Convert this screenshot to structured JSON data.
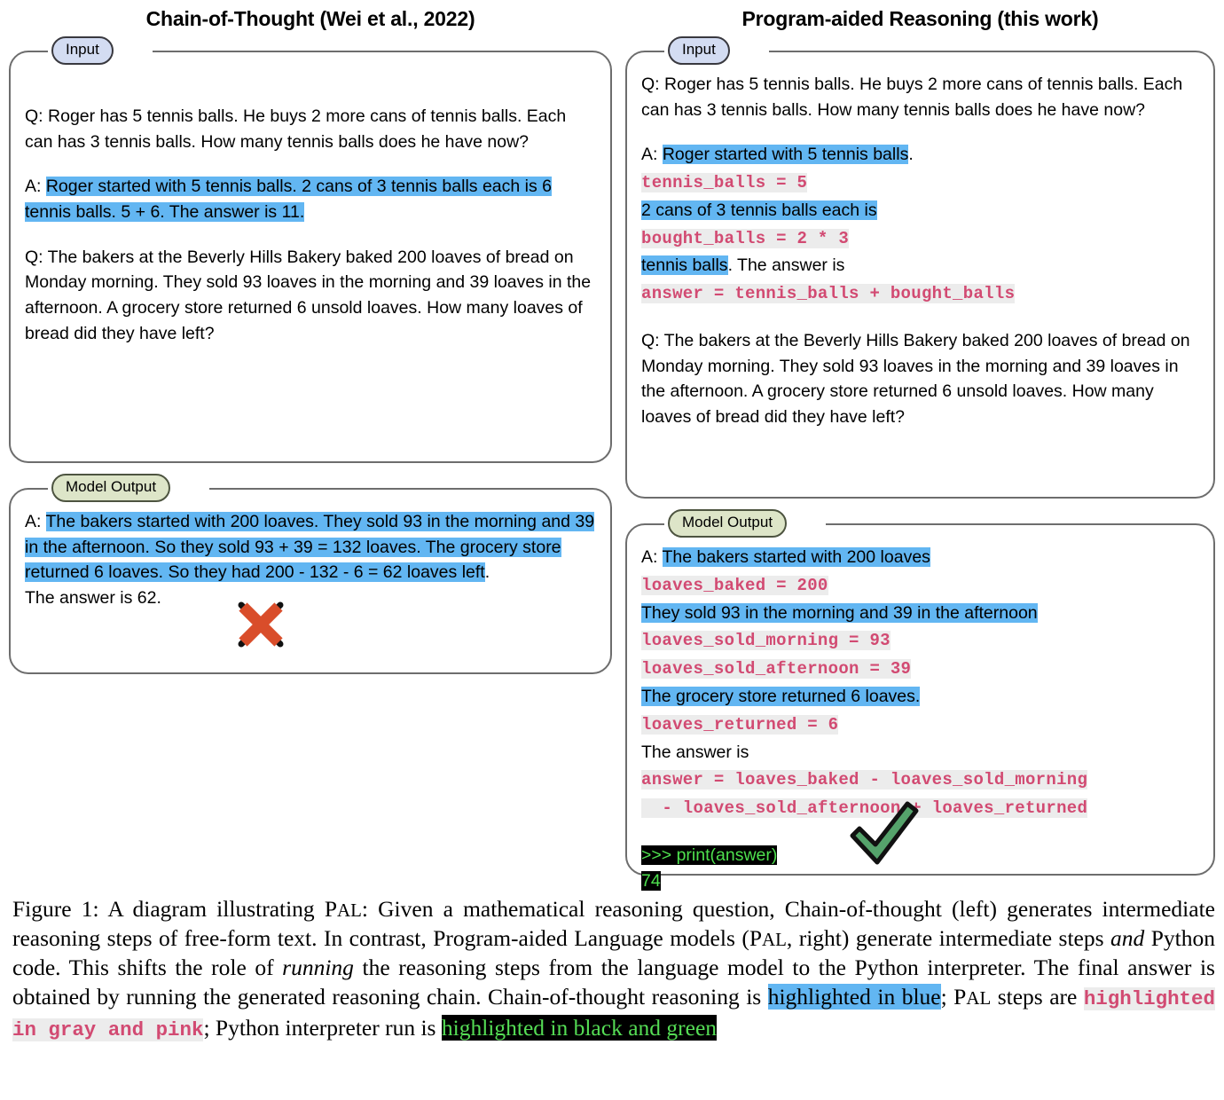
{
  "figure": {
    "left_column": {
      "title": "Chain-of-Thought (Wei et al., 2022)",
      "input_label": "Input",
      "output_label": "Model Output",
      "input": {
        "q1_prefix": "Q: ",
        "q1": "Roger has 5 tennis balls. He buys 2 more cans of tennis balls. Each can has 3 tennis balls. How many tennis balls does he have now?",
        "a1_prefix": "A: ",
        "a1_highlighted": "Roger started with 5 tennis balls. 2 cans of 3 tennis balls each is 6 tennis balls. 5 + 6. The answer is 11.",
        "q2_prefix": "Q: ",
        "q2": "The bakers at the Beverly Hills Bakery baked 200 loaves of bread on Monday morning. They sold 93 loaves in the morning and 39 loaves in the afternoon. A grocery store returned 6 unsold loaves. How many loaves of bread did they have left?"
      },
      "output": {
        "a_prefix": "A: ",
        "a_highlighted": "The bakers started with 200 loaves. They sold 93 in the morning and 39 in the afternoon. So they sold 93 + 39 = 132 loaves. The grocery store returned 6 loaves. So they had 200 - 132 - 6 = 62 loaves left",
        "a_tail": ".",
        "final_line": "The answer is 62.",
        "verdict": "incorrect",
        "verdict_icon": "cross-mark-icon"
      }
    },
    "right_column": {
      "title": "Program-aided Reasoning (this work)",
      "input_label": "Input",
      "output_label": "Model Output",
      "input": {
        "q1_prefix": "Q: ",
        "q1": "Roger has 5 tennis balls. He buys 2 more cans of tennis balls. Each can has 3 tennis balls. How many tennis balls does he have now?",
        "a1_prefix": "A: ",
        "lines": [
          {
            "kind": "blue",
            "text": "Roger started with 5 tennis balls"
          },
          {
            "kind": "plain",
            "text": "."
          },
          {
            "kind": "code",
            "text": "tennis_balls = 5"
          },
          {
            "kind": "blue",
            "text": "2 cans of 3 tennis balls each is"
          },
          {
            "kind": "code",
            "text": "bought_balls = 2 * 3"
          },
          {
            "kind": "blue",
            "text": "tennis balls"
          },
          {
            "kind": "plain",
            "text": ". The answer is"
          },
          {
            "kind": "code",
            "text": "answer = tennis_balls + bought_balls"
          }
        ],
        "q2_prefix": "Q: ",
        "q2": "The bakers at the Beverly Hills Bakery baked 200 loaves of bread on Monday morning. They sold 93 loaves in the morning and 39 loaves in the afternoon. A grocery store returned 6 unsold loaves. How many loaves of bread did they have left?"
      },
      "output": {
        "a_prefix": "A: ",
        "lines": [
          {
            "kind": "blue",
            "text": "The bakers started with 200 loaves"
          },
          {
            "kind": "code",
            "text": "loaves_baked = 200"
          },
          {
            "kind": "blue",
            "text": "They sold 93 in the morning and 39 in the afternoon"
          },
          {
            "kind": "code",
            "text": "loaves_sold_morning = 93"
          },
          {
            "kind": "code",
            "text": "loaves_sold_afternoon = 39"
          },
          {
            "kind": "blue",
            "text": "The grocery store returned 6 loaves."
          },
          {
            "kind": "code",
            "text": "loaves_returned = 6"
          },
          {
            "kind": "plain",
            "text": "The answer is"
          },
          {
            "kind": "code",
            "text": "answer = loaves_baked - loaves_sold_morning"
          },
          {
            "kind": "code",
            "text": "  - loaves_sold_afternoon + loaves_returned"
          }
        ],
        "terminal": {
          "prompt_line": ">>> print(answer)",
          "result_line": "74"
        },
        "verdict": "correct",
        "verdict_icon": "check-mark-icon"
      }
    }
  },
  "caption": {
    "label": "Figure 1:",
    "part1": " A diagram illustrating P",
    "sc1": "AL",
    "part2": ": Given a mathematical reasoning question, Chain-of-thought (left) generates intermediate reasoning steps of free-form text. In contrast, Program-aided Language models (P",
    "sc2": "AL",
    "part3": ", right) generate intermediate steps ",
    "italic1": "and",
    "part4": " Python code. This shifts the role of ",
    "italic2": "running",
    "part5": " the reasoning steps from the language model to the Python interpreter. The final answer is obtained by running the generated reasoning chain. Chain-of-thought reasoning is ",
    "hl_blue": "highlighted in blue",
    "part6": "; P",
    "sc3": "AL",
    "part7": " steps are ",
    "hl_code": "highlighted in gray and pink",
    "part8": "; Python interpreter run is ",
    "hl_term": "highlighted in black and green"
  },
  "colors": {
    "blue_highlight": "#62b6f2",
    "code_pink": "#d24a72",
    "code_gray_bg": "#ececec",
    "terminal_bg": "#000000",
    "terminal_green": "#4ee04e",
    "pill_input_bg": "#d3dcf2",
    "pill_output_bg": "#dde5c8",
    "panel_border": "#6d6d6d",
    "cross_red": "#d94d2a",
    "check_green": "#55a36b"
  }
}
